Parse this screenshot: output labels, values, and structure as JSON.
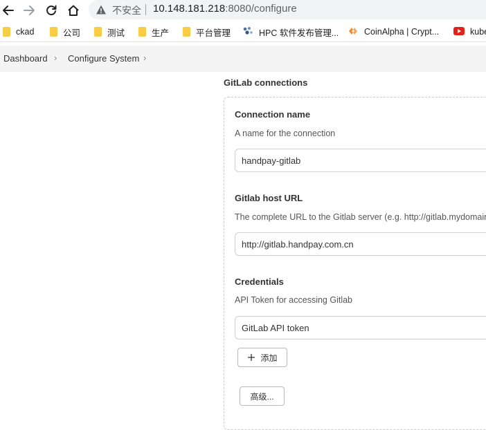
{
  "browser": {
    "security_label": "不安全",
    "url_host": "10.148.181.218",
    "url_rest": ":8080/configure",
    "bookmarks": [
      {
        "label": "ckad",
        "icon": "folder-icon"
      },
      {
        "label": "公司",
        "icon": "folder-icon"
      },
      {
        "label": "测试",
        "icon": "folder-icon"
      },
      {
        "label": "生产",
        "icon": "folder-icon"
      },
      {
        "label": "平台管理",
        "icon": "folder-icon"
      },
      {
        "label": "HPC  软件发布管理...",
        "icon": "hpc-icon"
      },
      {
        "label": "CoinAlpha | Crypt...",
        "icon": "coinalpha-icon"
      },
      {
        "label": "kube",
        "icon": "youtube-icon"
      }
    ]
  },
  "breadcrumb": {
    "items": [
      "Dashboard",
      "Configure System"
    ]
  },
  "gitlab": {
    "section_title": "GitLab connections",
    "connection_name": {
      "label": "Connection name",
      "description": "A name for the connection",
      "value": "handpay-gitlab"
    },
    "host_url": {
      "label": "Gitlab host URL",
      "description": "The complete URL to the Gitlab server (e.g. http://gitlab.mydomain.",
      "value": "http://gitlab.handpay.com.cn"
    },
    "credentials": {
      "label": "Credentials",
      "description": "API Token for accessing Gitlab",
      "selected": "GitLab API token",
      "add_label": "添加"
    },
    "advanced_label": "高级..."
  }
}
